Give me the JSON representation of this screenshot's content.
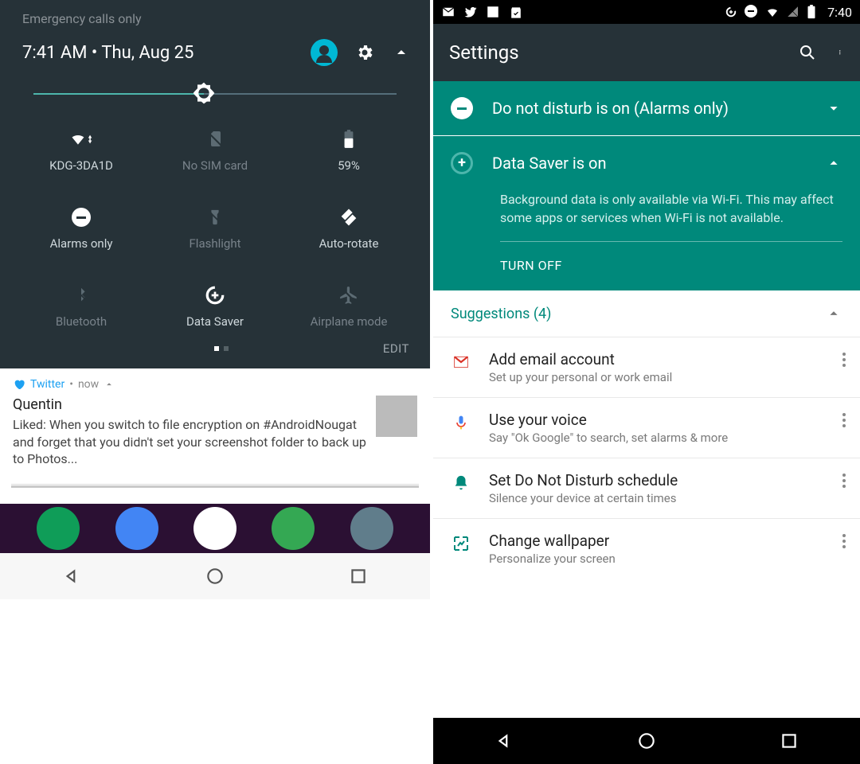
{
  "left": {
    "emergency": "Emergency calls only",
    "time_date": "7:41 AM  •  Thu, Aug 25",
    "tiles": [
      {
        "label": "KDG-3DA1D",
        "state": "active"
      },
      {
        "label": "No SIM card",
        "state": "inactive"
      },
      {
        "label": "59%",
        "state": "active"
      },
      {
        "label": "Alarms only",
        "state": "active"
      },
      {
        "label": "Flashlight",
        "state": "inactive"
      },
      {
        "label": "Auto-rotate",
        "state": "active"
      },
      {
        "label": "Bluetooth",
        "state": "inactive"
      },
      {
        "label": "Data Saver",
        "state": "active"
      },
      {
        "label": "Airplane mode",
        "state": "inactive"
      }
    ],
    "edit": "EDIT",
    "notif": {
      "app": "Twitter",
      "time": "now",
      "title": "Quentin",
      "body": "Liked: When you switch to file encryption on #AndroidNougat and forget that you didn't set your screenshot folder to back up to Photos..."
    }
  },
  "right": {
    "status_time": "7:40",
    "appbar_title": "Settings",
    "dnd_title": "Do not disturb is on (Alarms only)",
    "ds_title": "Data Saver is on",
    "ds_desc": "Background data is only available via Wi-Fi. This may affect some apps or services when Wi-Fi is not available.",
    "turn_off": "TURN OFF",
    "suggestions_header": "Suggestions (4)",
    "suggestions": [
      {
        "title": "Add email account",
        "sub": "Set up your personal or work email"
      },
      {
        "title": "Use your voice",
        "sub": "Say \"Ok Google\" to search, set alarms & more"
      },
      {
        "title": "Set Do Not Disturb schedule",
        "sub": "Silence your device at certain times"
      },
      {
        "title": "Change wallpaper",
        "sub": "Personalize your screen"
      }
    ]
  }
}
